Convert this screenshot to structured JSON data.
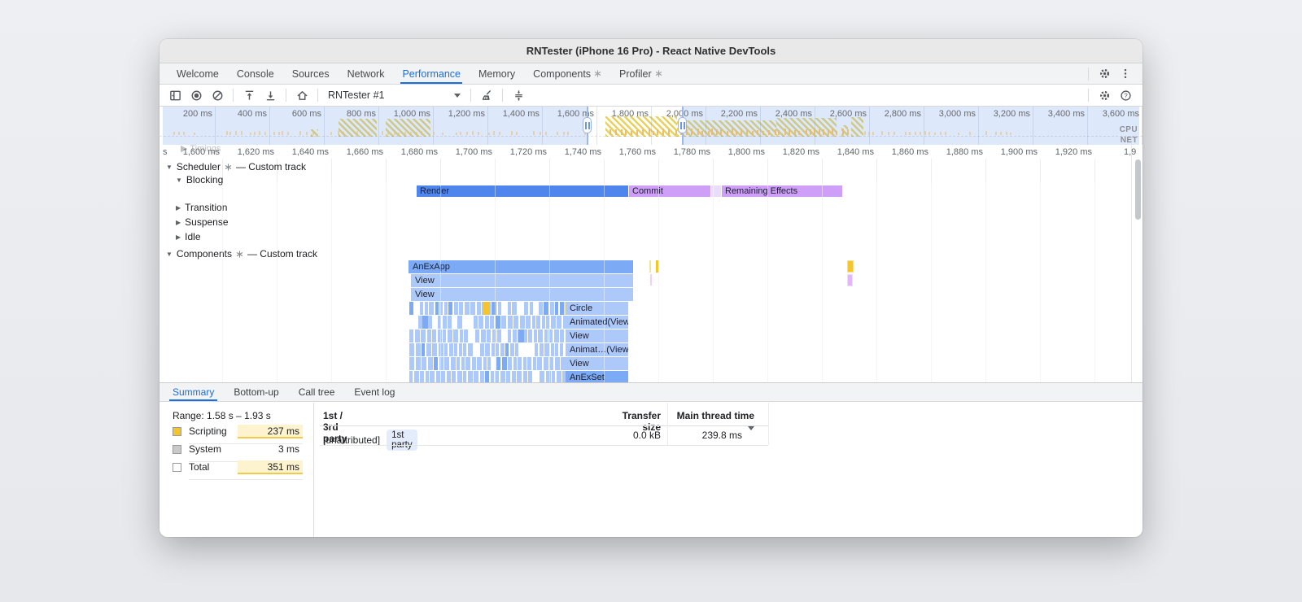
{
  "window": {
    "title": "RNTester (iPhone 16 Pro) - React Native DevTools"
  },
  "devtools_tabs": [
    {
      "label": "Welcome",
      "active": false,
      "badge": false
    },
    {
      "label": "Console",
      "active": false,
      "badge": false
    },
    {
      "label": "Sources",
      "active": false,
      "badge": false
    },
    {
      "label": "Network",
      "active": false,
      "badge": false
    },
    {
      "label": "Performance",
      "active": true,
      "badge": false
    },
    {
      "label": "Memory",
      "active": false,
      "badge": false
    },
    {
      "label": "Components",
      "active": false,
      "badge": true
    },
    {
      "label": "Profiler",
      "active": false,
      "badge": true
    }
  ],
  "toolbar": {
    "target": "RNTester #1"
  },
  "overview": {
    "tick_labels": [
      "200 ms",
      "400 ms",
      "600 ms",
      "800 ms",
      "1,000 ms",
      "1,200 ms",
      "1,400 ms",
      "1,600 ms",
      "1,800 ms",
      "2,000 ms",
      "2,200 ms",
      "2,400 ms",
      "2,600 ms",
      "2,800 ms",
      "3,000 ms",
      "3,200 ms",
      "3,400 ms",
      "3,600 ms"
    ],
    "cpu_label": "CPU",
    "net_label": "NET"
  },
  "ruler": {
    "clipped_left": "s",
    "tick_labels": [
      "1,600 ms",
      "1,620 ms",
      "1,640 ms",
      "1,660 ms",
      "1,680 ms",
      "1,700 ms",
      "1,720 ms",
      "1,740 ms",
      "1,760 ms",
      "1,780 ms",
      "1,800 ms",
      "1,820 ms",
      "1,840 ms",
      "1,860 ms",
      "1,880 ms",
      "1,900 ms",
      "1,920 ms"
    ],
    "clipped_right": "1,9"
  },
  "tracks": {
    "timings": "Timings",
    "scheduler_name": "Scheduler",
    "components_name": "Components",
    "custom_suffix": "— Custom track",
    "scheduler_children": [
      "Blocking",
      "Transition",
      "Suspense",
      "Idle"
    ]
  },
  "flame": {
    "scheduler_bars": [
      "Render",
      "Commit",
      "Remaining Effects"
    ],
    "component_rows": [
      "AnExApp",
      "View",
      "View",
      "Circle",
      "Animated(View)",
      "View",
      "Animat…(View)",
      "View",
      "AnExSet"
    ]
  },
  "panel": {
    "tabs": [
      "Summary",
      "Bottom-up",
      "Call tree",
      "Event log"
    ],
    "active_tab": "Summary"
  },
  "summary": {
    "range": "Range: 1.58 s – 1.93 s",
    "rows": [
      {
        "label": "Scripting",
        "value": "237 ms",
        "swatch": "#f2c430",
        "highlight": true
      },
      {
        "label": "System",
        "value": "3 ms",
        "swatch": "#c9c9c9",
        "highlight": false
      },
      {
        "label": "Total",
        "value": "351 ms",
        "swatch": "#ffffff",
        "highlight": true
      }
    ]
  },
  "party_table": {
    "col1": "1st / 3rd party",
    "col2": "Transfer size",
    "col3": "Main thread time",
    "row": {
      "name": "[unattributed]",
      "chip": "1st party",
      "transfer": "0.0 kB",
      "main_thread": "239.8 ms"
    }
  },
  "colors": {
    "accent_blue": "#1a6ee0",
    "render_blue": "#4e86ee",
    "purple": "#cf9ef7",
    "lavender": "#ecdcfc",
    "flame_medium": "#7daaf5",
    "flame_light": "#adc9fa",
    "flame_yellow": "#f6c52d",
    "pale_yellow": "#f3e39a",
    "marker_purple": "#e3b6f8",
    "pink_tick": "#f0cdf2",
    "traffic": [
      "#ff5f57",
      "#febc2e",
      "#28c840"
    ]
  }
}
